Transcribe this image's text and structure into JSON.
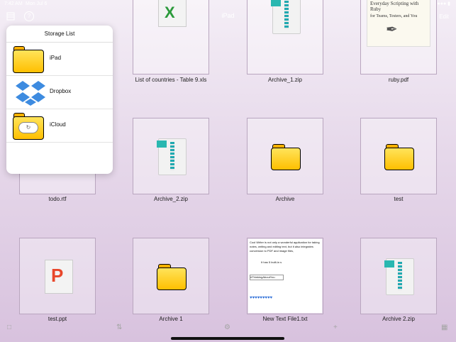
{
  "status": {
    "time": "7:42 AM",
    "date": "Mon Jul 6"
  },
  "nav": {
    "title": "iPad",
    "edit": "Edit",
    "help": "?"
  },
  "files": [
    {
      "name": "List of countries - Table 9.xls",
      "type": "xls"
    },
    {
      "name": "Archive_1.zip",
      "type": "zip"
    },
    {
      "name": "ruby.pdf",
      "type": "pdf"
    },
    {
      "name": "todo.rtf",
      "type": "rtf"
    },
    {
      "name": "Archive_2.zip",
      "type": "zip"
    },
    {
      "name": "Archive",
      "type": "folder"
    },
    {
      "name": "test",
      "type": "folder"
    },
    {
      "name": "test.ppt",
      "type": "ppt"
    },
    {
      "name": "Archive 1",
      "type": "folder"
    },
    {
      "name": "New Text File1.txt",
      "type": "txt"
    },
    {
      "name": "Archive 2.zip",
      "type": "zip"
    }
  ],
  "pdf_preview": {
    "title": "Everyday Scripting with Ruby",
    "subtitle": "for Teams, Testers, and You"
  },
  "txt_preview": {
    "line1": "Cool Writer is not only a wonderful application for taking notes, writing and editing text, but it also integrates conversion to PDF and image files,",
    "line2": "It has 5 built-in s",
    "line3": "#ThinkingAboutYou"
  },
  "popover": {
    "title": "Storage List",
    "items": [
      {
        "label": "iPad"
      },
      {
        "label": "Dropbox"
      },
      {
        "label": "iCloud"
      }
    ]
  }
}
